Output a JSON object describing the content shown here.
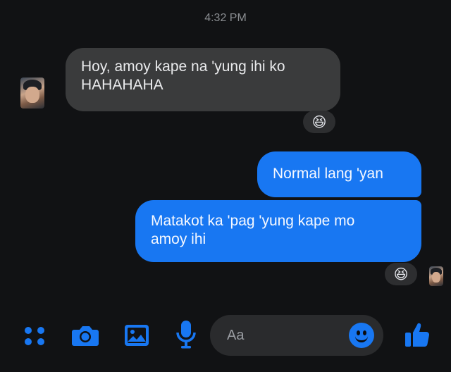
{
  "timestamp": "4:32 PM",
  "messages": [
    {
      "direction": "incoming",
      "text_line1": "Hoy, amoy kape na 'yung ihi ko",
      "text_line2": "HAHAHAHA",
      "reaction": "😆"
    },
    {
      "direction": "outgoing",
      "text": "Normal lang 'yan"
    },
    {
      "direction": "outgoing",
      "text_line1": "Matakot ka 'pag 'yung kape mo",
      "text_line2": "amoy ihi",
      "reaction": "😆"
    }
  ],
  "composer": {
    "placeholder": "Aa",
    "icons": [
      "apps-icon",
      "camera-icon",
      "gallery-icon",
      "microphone-icon",
      "emoji-icon",
      "thumbs-up-icon"
    ]
  },
  "colors": {
    "background": "#111214",
    "incoming_bubble": "#3a3b3c",
    "outgoing_bubble": "#1877f2",
    "accent": "#1877f2"
  }
}
